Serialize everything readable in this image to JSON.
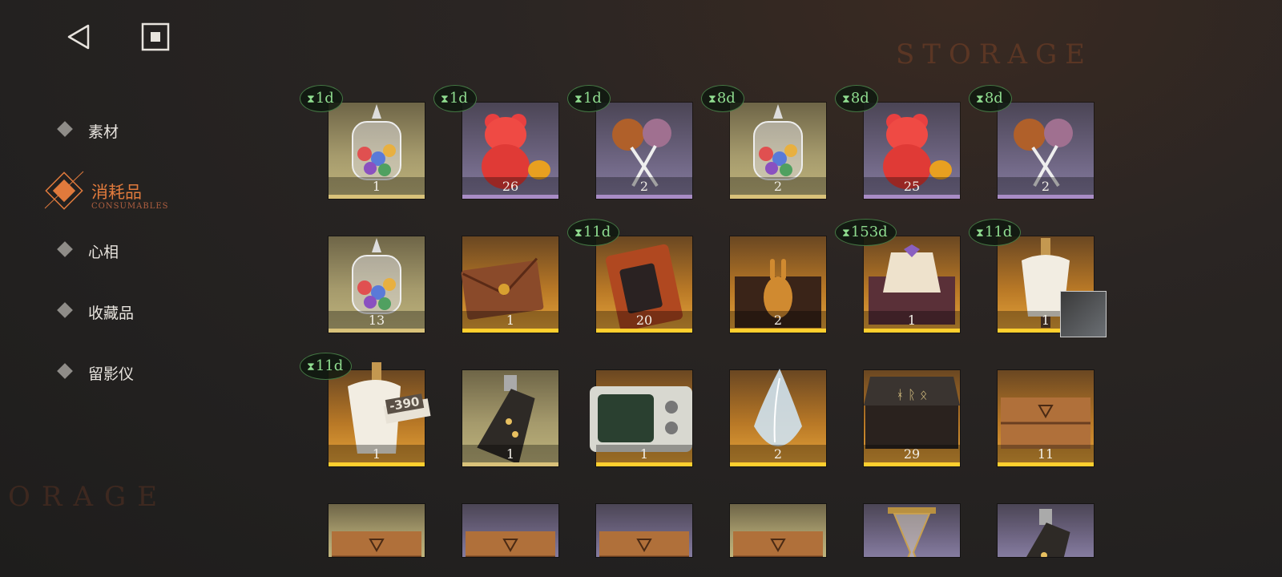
{
  "background": {
    "watermark": "STORAGE",
    "watermark_bottom": "ORAGE"
  },
  "icons": {
    "back": "back-triangle-icon",
    "home": "home-square-icon"
  },
  "sidebar": {
    "items": [
      {
        "label": "素材",
        "sub": "",
        "active": false
      },
      {
        "label": "消耗品",
        "sub": "CONSUMABLES",
        "active": true
      },
      {
        "label": "心相",
        "sub": "",
        "active": false
      },
      {
        "label": "收藏品",
        "sub": "",
        "active": false
      },
      {
        "label": "留影仪",
        "sub": "",
        "active": false
      }
    ],
    "accent": "#e07a3c"
  },
  "items": [
    {
      "name": "candy-jar",
      "count": "1",
      "timer": "1d",
      "rarity": "gold"
    },
    {
      "name": "gummy-bear",
      "count": "26",
      "timer": "1d",
      "rarity": "purple"
    },
    {
      "name": "lollipops",
      "count": "2",
      "timer": "1d",
      "rarity": "purple"
    },
    {
      "name": "candy-jar",
      "count": "2",
      "timer": "8d",
      "rarity": "gold"
    },
    {
      "name": "gummy-bear",
      "count": "25",
      "timer": "8d",
      "rarity": "purple"
    },
    {
      "name": "lollipops",
      "count": "2",
      "timer": "8d",
      "rarity": "purple"
    },
    {
      "name": "candy-jar",
      "count": "13",
      "timer": "",
      "rarity": "gold"
    },
    {
      "name": "envelope",
      "count": "1",
      "timer": "",
      "rarity": "orange"
    },
    {
      "name": "ticket-book",
      "count": "20",
      "timer": "11d",
      "rarity": "orange"
    },
    {
      "name": "rabbit-box",
      "count": "2",
      "timer": "",
      "rarity": "orange"
    },
    {
      "name": "outfit-box",
      "count": "1",
      "timer": "153d",
      "rarity": "orange"
    },
    {
      "name": "mannequin",
      "count": "1",
      "timer": "11d",
      "rarity": "orange"
    },
    {
      "name": "mannequin-tag",
      "count": "1",
      "timer": "11d",
      "rarity": "orange"
    },
    {
      "name": "bottle",
      "count": "1",
      "timer": "",
      "rarity": "gold"
    },
    {
      "name": "tv-set",
      "count": "1",
      "timer": "",
      "rarity": "orange"
    },
    {
      "name": "crystal-shard",
      "count": "2",
      "timer": "",
      "rarity": "orange"
    },
    {
      "name": "rune-chest",
      "count": "29",
      "timer": "",
      "rarity": "orange"
    },
    {
      "name": "wooden-crate",
      "count": "11",
      "timer": "",
      "rarity": "orange"
    },
    {
      "name": "wooden-crate",
      "count": "",
      "timer": "",
      "rarity": "gold"
    },
    {
      "name": "wooden-crate",
      "count": "",
      "timer": "",
      "rarity": "purple"
    },
    {
      "name": "wooden-crate",
      "count": "",
      "timer": "",
      "rarity": "purple"
    },
    {
      "name": "wooden-crate",
      "count": "",
      "timer": "",
      "rarity": "gold"
    },
    {
      "name": "hourglass",
      "count": "",
      "timer": "",
      "rarity": "purple"
    },
    {
      "name": "bottle",
      "count": "",
      "timer": "",
      "rarity": "purple"
    }
  ],
  "mannequin_price_tag": "-390"
}
